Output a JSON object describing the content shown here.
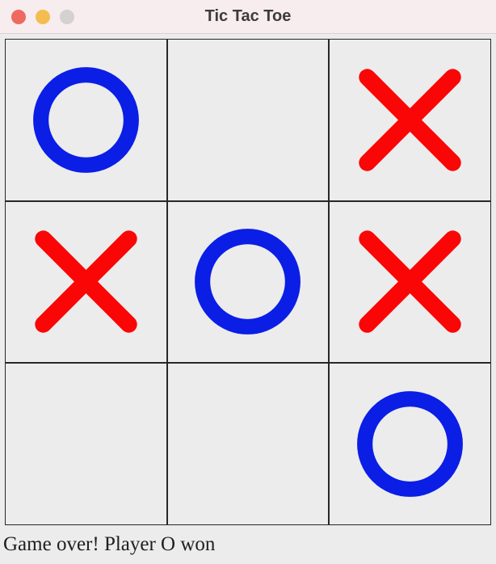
{
  "window": {
    "title": "Tic Tac Toe"
  },
  "board": {
    "cells": [
      [
        "O",
        "",
        "X"
      ],
      [
        "X",
        "O",
        "X"
      ],
      [
        "",
        "",
        "O"
      ]
    ]
  },
  "status": {
    "text": "Game over! Player O won"
  },
  "colors": {
    "x": "#fb0606",
    "o": "#0b1ee6",
    "grid": "#272727",
    "bg": "#ececec",
    "titlebar": "#f7ecee"
  },
  "icons": {
    "o": "circle-icon",
    "x": "cross-icon"
  }
}
